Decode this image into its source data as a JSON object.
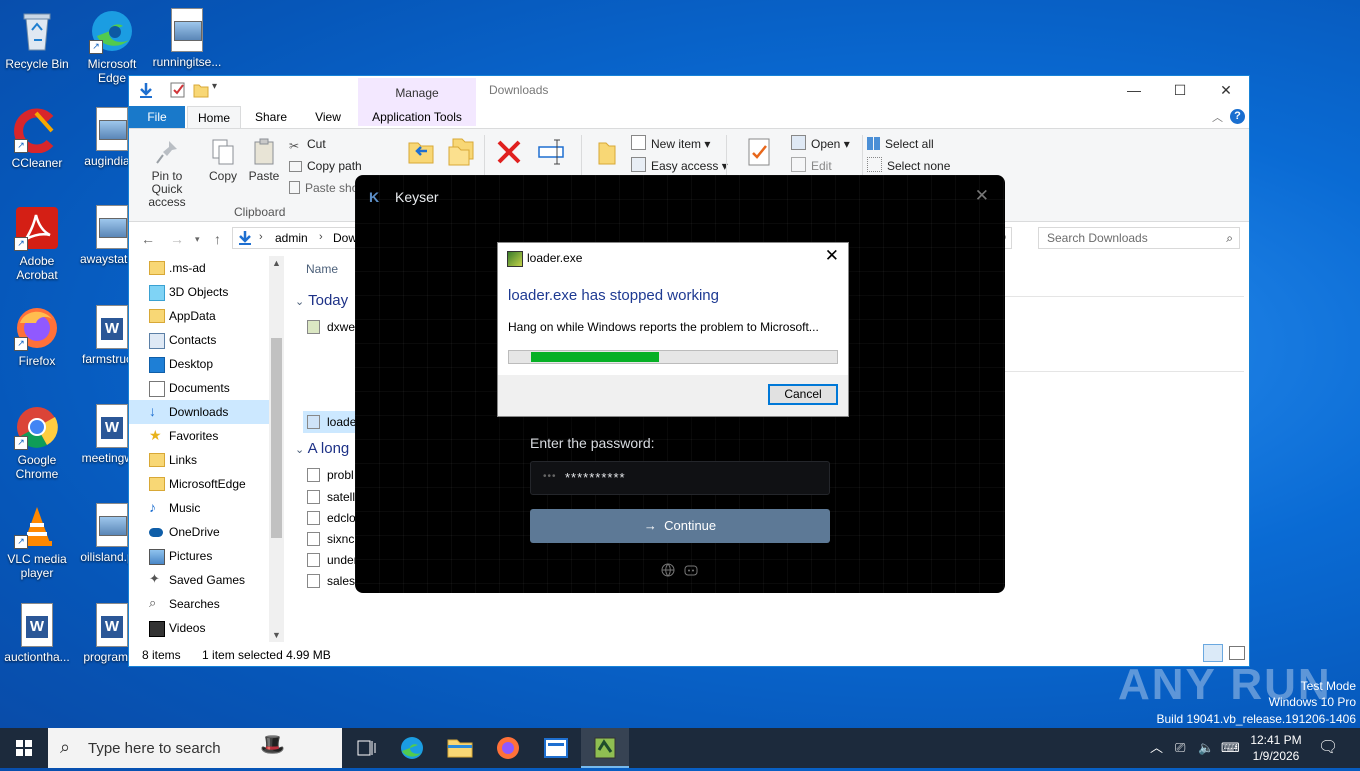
{
  "desktop": {
    "icons": [
      {
        "label": "Recycle Bin"
      },
      {
        "label": "Microsoft Edge"
      },
      {
        "label": "runningitse..."
      },
      {
        "label": "CCleaner"
      },
      {
        "label": "augindia..."
      },
      {
        "label": "Adobe Acrobat"
      },
      {
        "label": "awaystate..."
      },
      {
        "label": "Firefox"
      },
      {
        "label": "farmstruc..."
      },
      {
        "label": "Google Chrome"
      },
      {
        "label": "meetingw..."
      },
      {
        "label": "VLC media player"
      },
      {
        "label": "oilisland.p..."
      },
      {
        "label": "auctiontha..."
      },
      {
        "label": "programi..."
      }
    ]
  },
  "explorer": {
    "title": "Downloads",
    "context_tab": "Manage",
    "tabs": [
      "File",
      "Home",
      "Share",
      "View",
      "Application Tools"
    ],
    "ribbon": {
      "pin_label": "Pin to Quick access",
      "copy_label": "Copy",
      "paste_label": "Paste",
      "cut_label": "Cut",
      "copy_path_label": "Copy path",
      "paste_shortcut_label": "Paste sho",
      "clipboard_group": "Clipboard",
      "new_item_label": "New item",
      "easy_access_label": "Easy access",
      "open_label": "Open",
      "edit_label": "Edit",
      "select_all_label": "Select all",
      "select_none_label": "Select none"
    },
    "address": {
      "crumbs": [
        "admin",
        "Dow"
      ]
    },
    "search_placeholder": "Search Downloads",
    "nav_items": [
      ".ms-ad",
      "3D Objects",
      "AppData",
      "Contacts",
      "Desktop",
      "Documents",
      "Downloads",
      "Favorites",
      "Links",
      "MicrosoftEdge",
      "Music",
      "OneDrive",
      "Pictures",
      "Saved Games",
      "Searches",
      "Videos"
    ],
    "selected_nav": "Downloads",
    "column_name": "Name",
    "groups": [
      {
        "label": "Today",
        "files": [
          "dxwe",
          "loade"
        ]
      },
      {
        "label": "A long",
        "files": [
          "probl",
          "satelli",
          "edclo",
          "sixnc.",
          "under",
          "salest"
        ]
      }
    ],
    "status_items": "8 items",
    "status_selected": "1 item selected  4.99 MB"
  },
  "keyser": {
    "title": "Keyser",
    "password_label": "Enter the password:",
    "password_value": "**********",
    "continue_label": "Continue",
    "arrow": "→"
  },
  "dialog": {
    "title": "loader.exe",
    "heading": "loader.exe has stopped working",
    "message": "Hang on while Windows reports the problem to Microsoft...",
    "progress": 0.39,
    "cancel_label": "Cancel"
  },
  "watermark": {
    "brand": "ANY RUN",
    "line1": "Test Mode",
    "line2": "Windows 10 Pro",
    "line3": "Build 19041.vb_release.191206-1406"
  },
  "taskbar": {
    "search_placeholder": "Type here to search",
    "time": "12:41 PM",
    "date": "1/9/2026"
  }
}
